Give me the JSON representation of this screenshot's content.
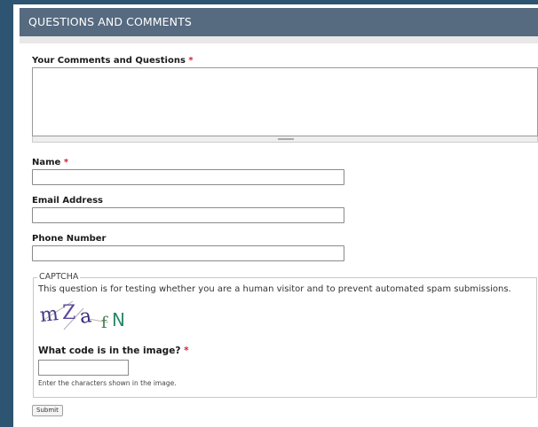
{
  "block": {
    "title": "QUESTIONS AND COMMENTS"
  },
  "required_marker": "*",
  "fields": {
    "comments": {
      "label": "Your Comments and Questions",
      "value": ""
    },
    "name": {
      "label": "Name",
      "value": ""
    },
    "email": {
      "label": "Email Address",
      "value": ""
    },
    "phone": {
      "label": "Phone Number",
      "value": ""
    }
  },
  "captcha": {
    "legend": "CAPTCHA",
    "description": "This question is for testing whether you are a human visitor and to prevent automated spam submissions.",
    "image_text": "mZafN",
    "question": "What code is in the image?",
    "help": "Enter the characters shown in the image.",
    "value": ""
  },
  "submit_label": "Submit",
  "colors": {
    "background": "#2d5470",
    "header": "#566a80",
    "required": "#d4202f",
    "captcha_ink": "#4a3a8c"
  }
}
